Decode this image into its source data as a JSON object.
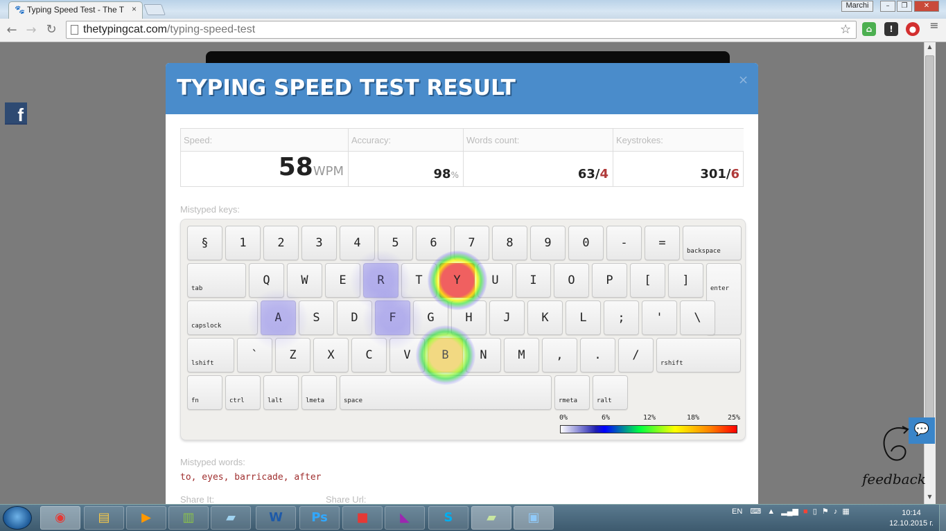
{
  "browser": {
    "tab_title": "Typing Speed Test - The T",
    "tab_close": "×",
    "user": "Marchi",
    "url_host": "thetypingcat.com",
    "url_path": "/typing-speed-test",
    "window_buttons": [
      "–",
      "❐",
      "✕"
    ]
  },
  "modal": {
    "title": "TYPING SPEED TEST RESULT",
    "close": "×",
    "stats": {
      "speed_label": "Speed:",
      "speed_value": "58",
      "speed_unit": "WPM",
      "accuracy_label": "Accuracy:",
      "accuracy_value": "98",
      "accuracy_unit": "%",
      "words_label": "Words count:",
      "words_value": "63/",
      "words_errors": "4",
      "keystrokes_label": "Keystrokes:",
      "keystrokes_value": "301/",
      "keystrokes_errors": "6"
    },
    "mistyped_keys_label": "Mistyped keys:",
    "keyboard": {
      "rows": [
        [
          "§",
          "1",
          "2",
          "3",
          "4",
          "5",
          "6",
          "7",
          "8",
          "9",
          "0",
          "-",
          "=",
          "backspace"
        ],
        [
          "tab",
          "Q",
          "W",
          "E",
          "R",
          "T",
          "Y",
          "U",
          "I",
          "O",
          "P",
          "[",
          "]",
          "enter"
        ],
        [
          "capslock",
          "A",
          "S",
          "D",
          "F",
          "G",
          "H",
          "J",
          "K",
          "L",
          ";",
          "'",
          "\\"
        ],
        [
          "lshift",
          "`",
          "Z",
          "X",
          "C",
          "V",
          "B",
          "N",
          "M",
          ",",
          ".",
          "/",
          "rshift"
        ],
        [
          "fn",
          "ctrl",
          "lalt",
          "lmeta",
          "space",
          "rmeta",
          "ralt"
        ]
      ],
      "heat": {
        "Y": 0.25,
        "B": 0.15,
        "R": 0.03,
        "F": 0.03,
        "A": 0.03
      }
    },
    "legend_ticks": [
      "0%",
      "6%",
      "12%",
      "18%",
      "25%"
    ],
    "mistyped_words_label": "Mistyped words:",
    "mistyped_words": "to, eyes, barricade, after",
    "share_label": "Share It:",
    "share_url_label": "Share Url:"
  },
  "feedback": {
    "label": "feedback"
  },
  "taskbar": {
    "lang": "EN",
    "time": "10:14",
    "date": "12.10.2015 г."
  },
  "colors": {
    "header": "#4a8ccb",
    "error": "#b03a3a",
    "heat_high": "#f06060",
    "heat_mid": "#f2d982"
  }
}
